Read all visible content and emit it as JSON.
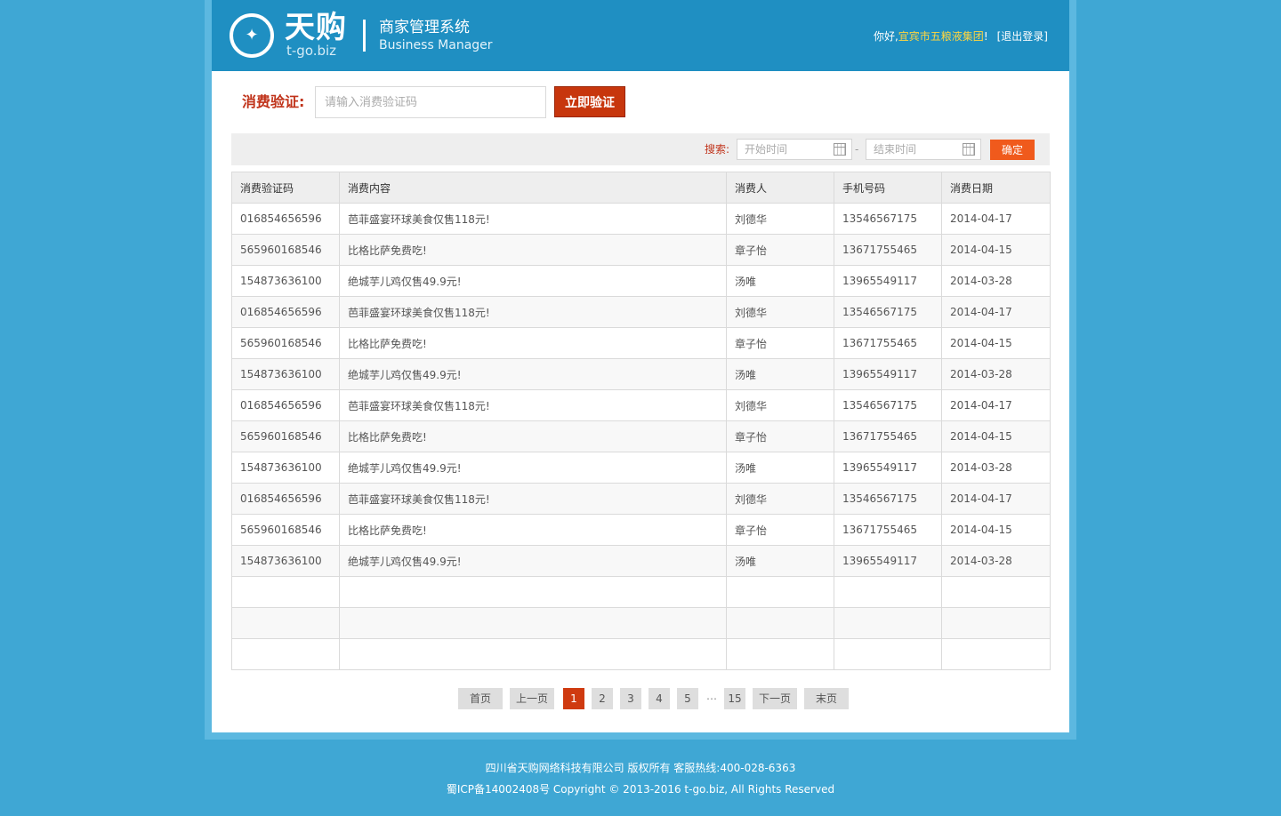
{
  "brand": {
    "cn": "天购",
    "en": "t-go.biz",
    "system_cn": "商家管理系统",
    "system_en": "Business Manager"
  },
  "user": {
    "greeting": "你好,",
    "company": "宜宾市五粮液集团",
    "suffix": "!",
    "logout": "[退出登录]"
  },
  "verify": {
    "label": "消费验证:",
    "placeholder": "请输入消费验证码",
    "button": "立即验证"
  },
  "search": {
    "label": "搜索:",
    "start_placeholder": "开始时间",
    "end_placeholder": "结束时间",
    "dash": "-",
    "button": "确定"
  },
  "table": {
    "headers": [
      "消费验证码",
      "消费内容",
      "消费人",
      "手机号码",
      "消费日期"
    ],
    "rows": [
      [
        "016854656596",
        "芭菲盛宴环球美食仅售118元!",
        "刘德华",
        "13546567175",
        "2014-04-17"
      ],
      [
        "565960168546",
        "比格比萨免费吃!",
        "章子怡",
        "13671755465",
        "2014-04-15"
      ],
      [
        "154873636100",
        "绝城芋儿鸡仅售49.9元!",
        "汤唯",
        "13965549117",
        "2014-03-28"
      ],
      [
        "016854656596",
        "芭菲盛宴环球美食仅售118元!",
        "刘德华",
        "13546567175",
        "2014-04-17"
      ],
      [
        "565960168546",
        "比格比萨免费吃!",
        "章子怡",
        "13671755465",
        "2014-04-15"
      ],
      [
        "154873636100",
        "绝城芋儿鸡仅售49.9元!",
        "汤唯",
        "13965549117",
        "2014-03-28"
      ],
      [
        "016854656596",
        "芭菲盛宴环球美食仅售118元!",
        "刘德华",
        "13546567175",
        "2014-04-17"
      ],
      [
        "565960168546",
        "比格比萨免费吃!",
        "章子怡",
        "13671755465",
        "2014-04-15"
      ],
      [
        "154873636100",
        "绝城芋儿鸡仅售49.9元!",
        "汤唯",
        "13965549117",
        "2014-03-28"
      ],
      [
        "016854656596",
        "芭菲盛宴环球美食仅售118元!",
        "刘德华",
        "13546567175",
        "2014-04-17"
      ],
      [
        "565960168546",
        "比格比萨免费吃!",
        "章子怡",
        "13671755465",
        "2014-04-15"
      ],
      [
        "154873636100",
        "绝城芋儿鸡仅售49.9元!",
        "汤唯",
        "13965549117",
        "2014-03-28"
      ],
      [
        "",
        "",
        "",
        "",
        ""
      ],
      [
        "",
        "",
        "",
        "",
        ""
      ],
      [
        "",
        "",
        "",
        "",
        ""
      ]
    ]
  },
  "pager": {
    "first": "首页",
    "prev": "上一页",
    "pages": [
      "1",
      "2",
      "3",
      "4",
      "5"
    ],
    "ellipsis": "…",
    "last_page": "15",
    "next": "下一页",
    "end": "末页",
    "current": "1"
  },
  "footer": {
    "line1": "四川省天购网络科技有限公司  版权所有   客服热线:400-028-6363",
    "line2": "蜀ICP备14002408号 Copyright © 2013-2016 t-go.biz, All Rights Reserved"
  },
  "colors": {
    "page_bg": "#3fa7d4",
    "header_bg": "#1f8fc2",
    "accent_red": "#c7360d",
    "accent_orange": "#f05a1c",
    "company_yellow": "#ffd640"
  }
}
